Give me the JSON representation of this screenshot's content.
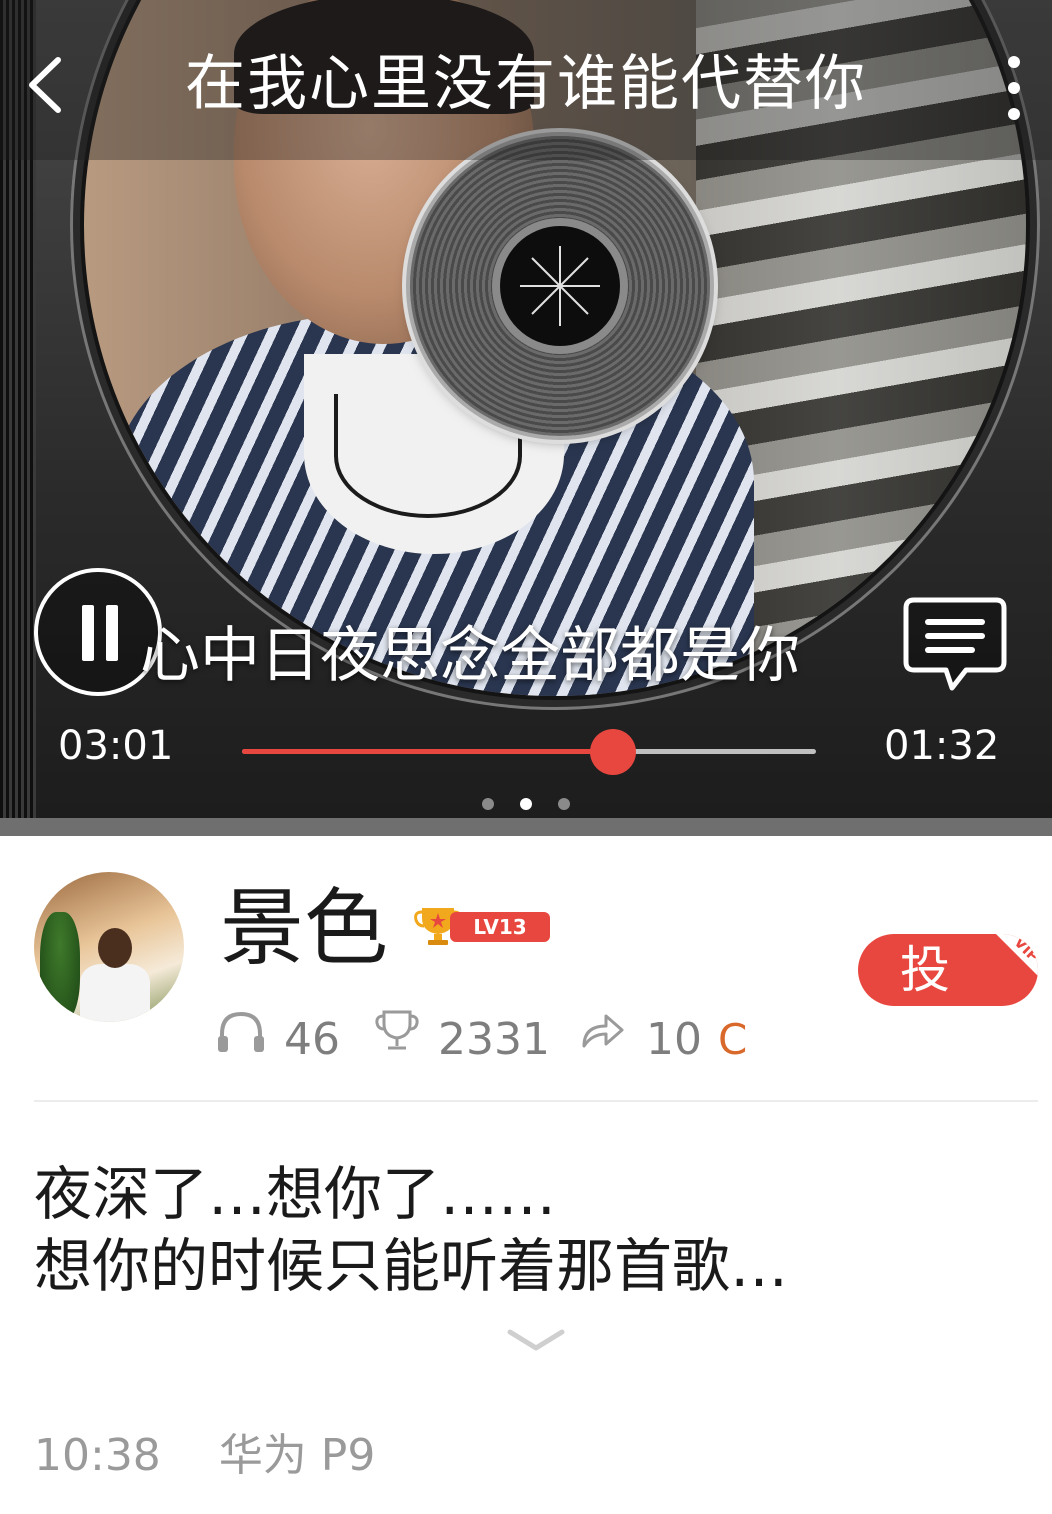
{
  "header": {
    "title": "在我心里没有谁能代替你"
  },
  "player": {
    "lyric": "心中日夜思念全部都是你",
    "elapsed": "03:01",
    "remaining": "01:32",
    "progress_fraction": 0.646,
    "page_dots": 3,
    "active_dot": 1,
    "accent_color": "#e8473f"
  },
  "user": {
    "name": "景色",
    "level": "LV13",
    "listens": "46",
    "trophies": "2331",
    "shares": "10",
    "coin_symbol": "C"
  },
  "vote_button": {
    "label": "投",
    "badge": "VIP"
  },
  "description": {
    "line1": "夜深了…想你了……",
    "line2": "想你的时候只能听着那首歌…"
  },
  "meta": {
    "time": "10:38",
    "device": "华为 P9"
  }
}
